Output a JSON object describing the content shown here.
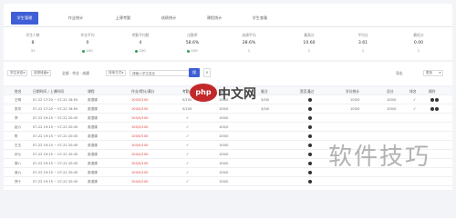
{
  "tabs": [
    {
      "label": "学生管理",
      "active": true
    },
    {
      "label": "作业统计"
    },
    {
      "label": "上课考勤"
    },
    {
      "label": "成绩统计"
    },
    {
      "label": "课程统计"
    },
    {
      "label": "学生查看"
    }
  ],
  "stats": [
    {
      "label": "学生人数",
      "value": "8",
      "sub": "31"
    },
    {
      "label": "作业平均",
      "value": "0",
      "sub": "100"
    },
    {
      "label": "考勤平均数",
      "value": "4",
      "sub": "100"
    },
    {
      "label": "出勤率",
      "value": "58.6%",
      "sub": "100"
    },
    {
      "label": "成绩平均",
      "value": "28.6%",
      "sub": "1"
    },
    {
      "label": "最高分",
      "value": "10.60",
      "sub": "1"
    },
    {
      "label": "平均分",
      "value": "3.61",
      "sub": "1"
    },
    {
      "label": "最低分",
      "value": "0.00",
      "sub": "1"
    }
  ],
  "filters": {
    "select1": "学生状态",
    "select2": "选择班级",
    "text1": "全部 · 作业 · 成绩",
    "select3": "排序方式",
    "input_placeholder": "请输入学生姓名",
    "search_label": "搜",
    "reset_label": "×",
    "export_label": "导出",
    "more_label": "更多"
  },
  "table": {
    "headers": [
      "姓名",
      "日期时间 / 上课时间",
      "课程",
      "作业/得分/满分",
      "考勤",
      "成绩",
      "备注",
      "是否通过",
      "学分统计",
      "总分",
      "排名",
      "操作"
    ],
    "rows": [
      {
        "name": "王明",
        "time": "07-22 17:20 ~ 07-22 18:50",
        "course": "英语课",
        "score": "100/0/100",
        "att": "0/100",
        "grade": "100/0",
        "note": "3/0/0",
        "rank_total": "100/0",
        "total": "100/0"
      },
      {
        "name": "张华",
        "time": "07-22 17:20 ~ 07-22 18:50",
        "course": "英语课",
        "score": "100/0/100",
        "att": "0/100",
        "grade": "100/0",
        "note": "3/0/0",
        "rank_total": "100/0",
        "total": "100/0"
      },
      {
        "name": "李",
        "time": "07-22 19:15 ~ 07-22 20:45",
        "course": "英语课",
        "score": "100/0/100",
        "att": "",
        "grade": "100/0",
        "note": "",
        "rank_total": "",
        "total": ""
      },
      {
        "name": "赵六",
        "time": "07-22 19:15 ~ 07-22 20:45",
        "course": "英语课",
        "score": "100/0/100",
        "att": "",
        "grade": "100/0",
        "note": "",
        "rank_total": "",
        "total": ""
      },
      {
        "name": "陈",
        "time": "07-22 19:15 ~ 07-22 20:45",
        "course": "英语课",
        "score": "100/0/100",
        "att": "",
        "grade": "100/0",
        "note": "",
        "rank_total": "",
        "total": ""
      },
      {
        "name": "王五",
        "time": "07-22 19:15 ~ 07-22 20:45",
        "course": "英语课",
        "score": "100/0/100",
        "att": "",
        "grade": "100/0",
        "note": "",
        "rank_total": "",
        "total": ""
      },
      {
        "name": "孙七",
        "time": "07-22 19:15 ~ 07-22 20:45",
        "course": "英语课",
        "score": "100/0/100",
        "att": "",
        "grade": "100/0",
        "note": "",
        "rank_total": "",
        "total": ""
      },
      {
        "name": "周八",
        "time": "07-22 19:15 ~ 07-22 20:45",
        "course": "英语课",
        "score": "100/0/100",
        "att": "",
        "grade": "100/0",
        "note": "",
        "rank_total": "",
        "total": ""
      },
      {
        "name": "吴九",
        "time": "07-22 19:15 ~ 07-22 20:45",
        "course": "英语课",
        "score": "100/0/100",
        "att": "",
        "grade": "100/0",
        "note": "",
        "rank_total": "",
        "total": ""
      },
      {
        "name": "郑十",
        "time": "07-22 19:15 ~ 07-22 20:45",
        "course": "英语课",
        "score": "100/0/100",
        "att": "",
        "grade": "100/0",
        "note": "",
        "rank_total": "",
        "total": ""
      }
    ],
    "side_values": [
      "100/0",
      "100/0"
    ]
  },
  "watermark": {
    "php_badge": "php",
    "php_word": "中文网",
    "big": "软件技巧"
  },
  "colors": {
    "accent": "#3f5fd6",
    "red": "#e03b3b",
    "green": "#2d9b5a"
  }
}
